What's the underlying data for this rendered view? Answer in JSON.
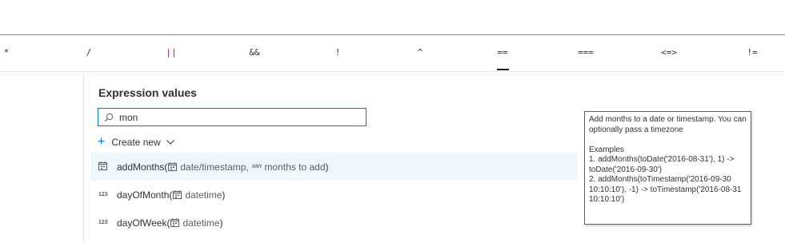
{
  "operators": [
    "*",
    "/",
    "||",
    "&&",
    "!",
    "^",
    "==",
    "===",
    "<=>",
    "!="
  ],
  "panel": {
    "title": "Expression values",
    "search": {
      "value": "mon",
      "placeholder": ""
    },
    "create_new_label": "Create new"
  },
  "functions": [
    {
      "type": "date",
      "name": "addMonths(",
      "params": [
        {
          "type": "date",
          "label": "date/timestamp"
        },
        {
          "type": "any",
          "label": "months to add"
        }
      ],
      "close": ")",
      "selected": true
    },
    {
      "type": "123",
      "name": "dayOfMonth(",
      "params": [
        {
          "type": "date",
          "label": "datetime"
        }
      ],
      "close": ")",
      "selected": false
    },
    {
      "type": "123",
      "name": "dayOfWeek(",
      "params": [
        {
          "type": "date",
          "label": "datetime"
        }
      ],
      "close": ")",
      "selected": false
    }
  ],
  "labels": {
    "type_123": "123",
    "type_any": "ANY",
    "separator": " , "
  },
  "tooltip": {
    "description": "Add months to a date or timestamp. You can optionally pass a timezone",
    "examples_heading": "Examples",
    "example_1": "1. addMonths(toDate('2016-08-31'), 1) -> toDate('2016-09-30')",
    "example_2": "2. addMonths(toTimestamp('2016-09-30 10:10:10'), -1) -> toTimestamp('2016-08-31 10:10:10')"
  },
  "colors": {
    "accent": "#0078d4",
    "selected_row": "#eff6fc",
    "pipe_operator": "#8b1a6b"
  }
}
